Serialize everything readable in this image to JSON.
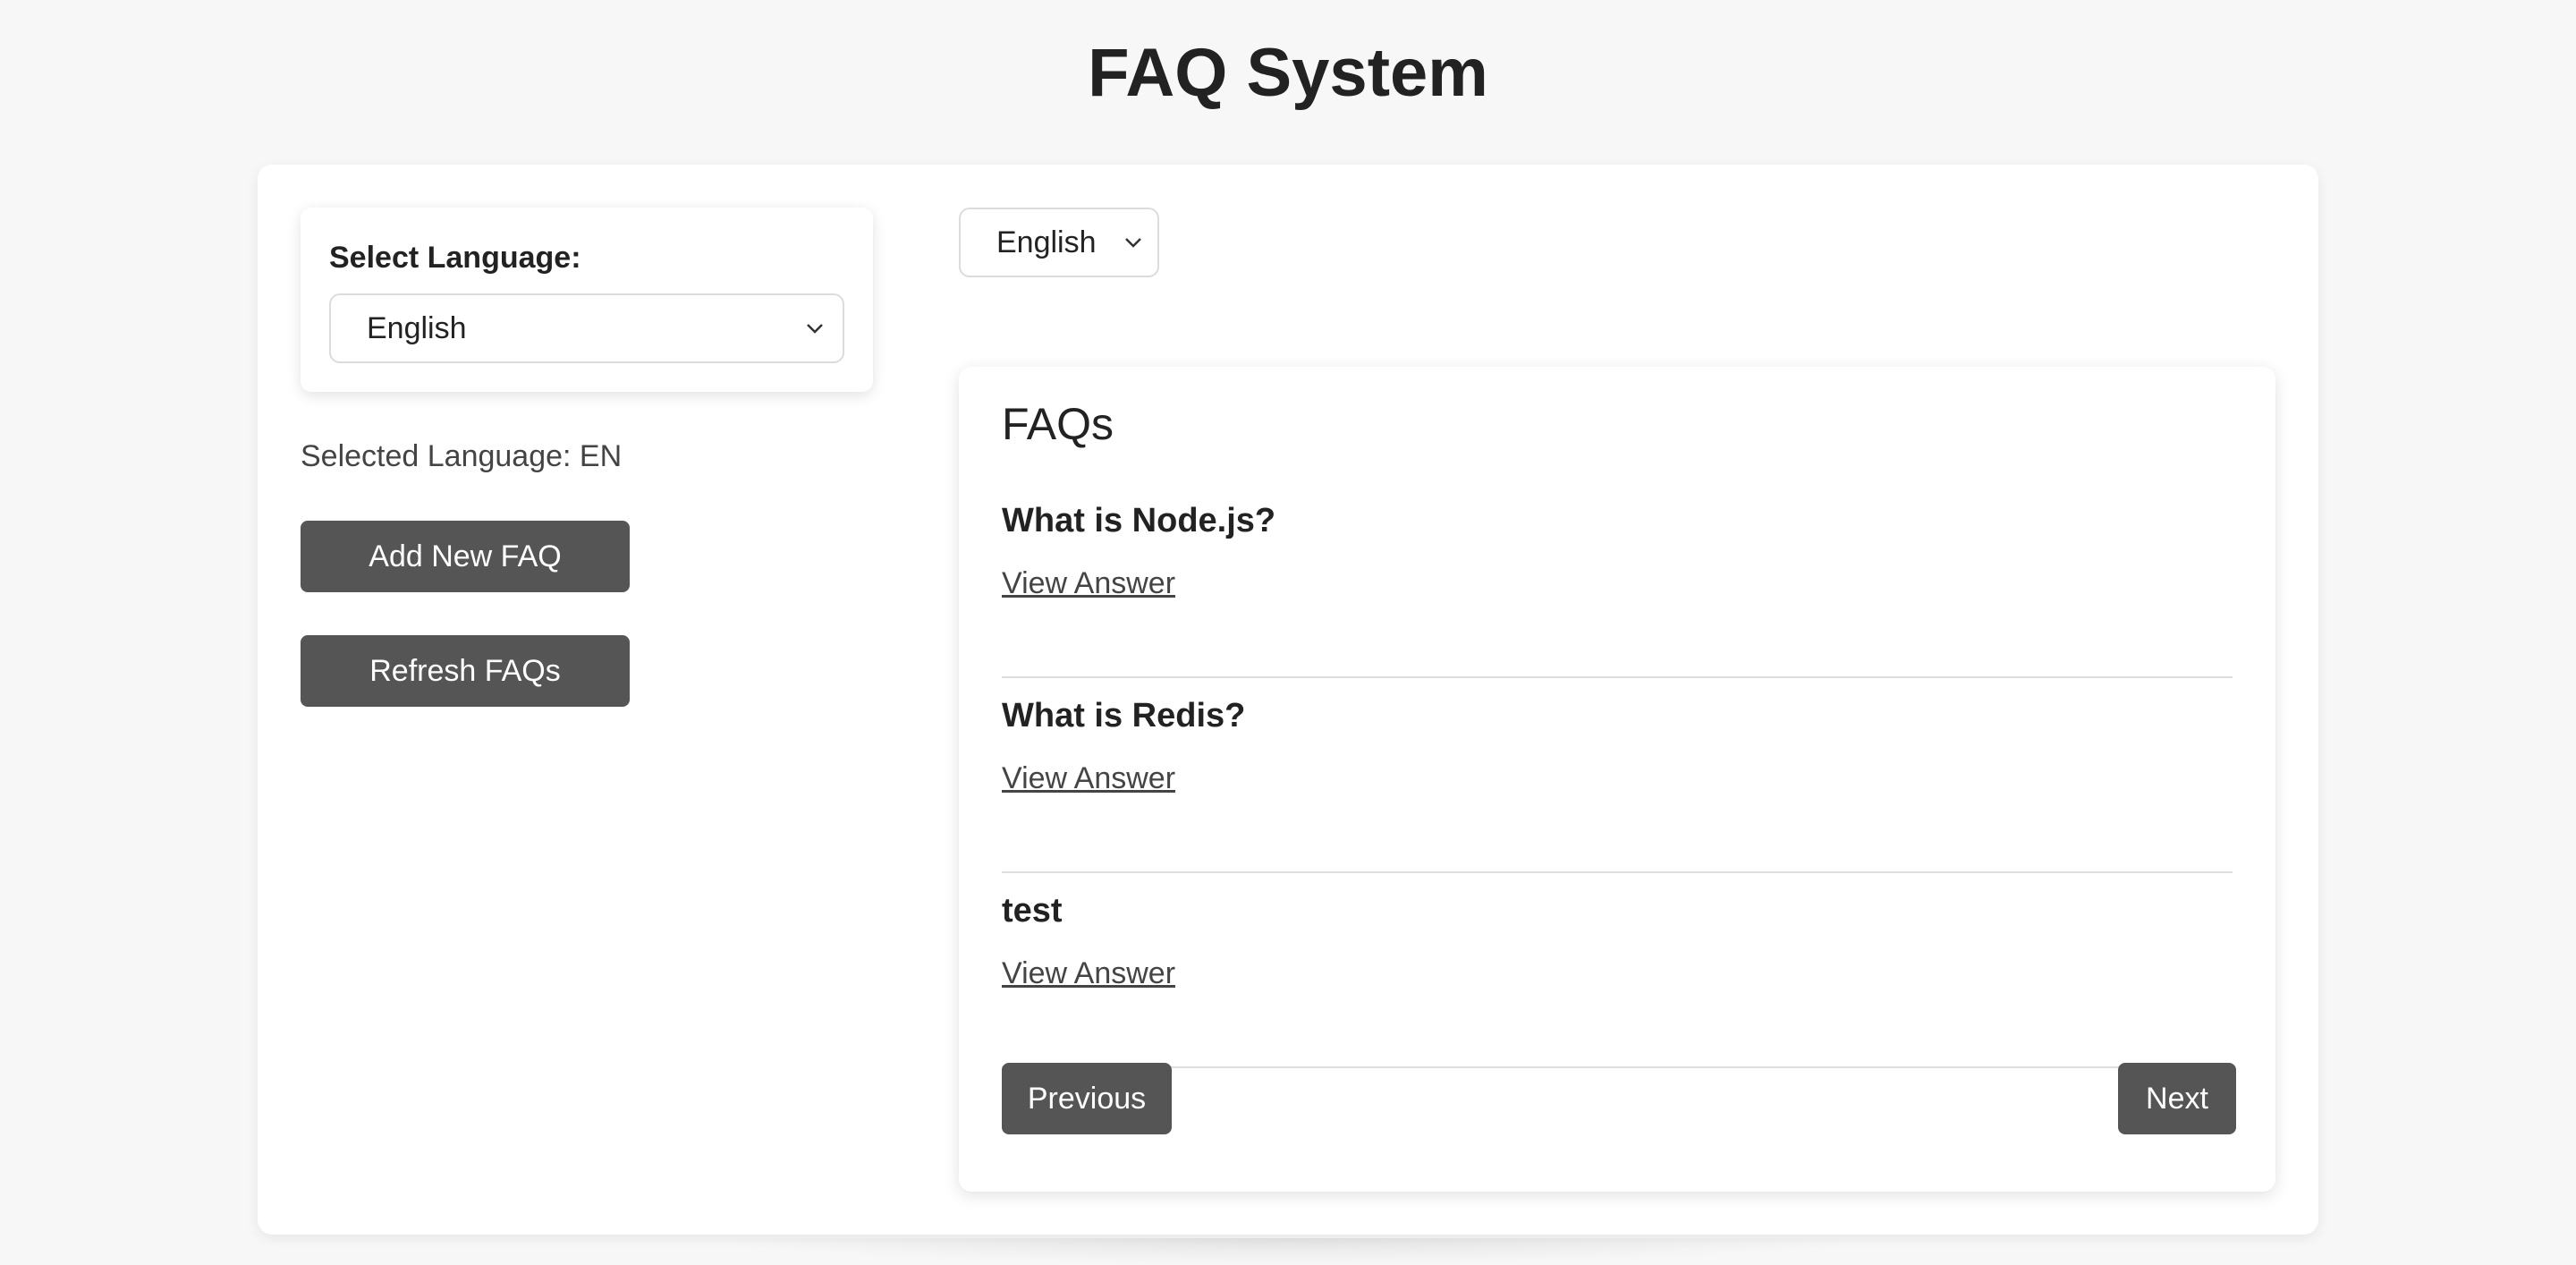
{
  "header": {
    "title": "FAQ System"
  },
  "sidebar": {
    "select_label": "Select Language:",
    "select_value": "English",
    "selected_language_text": "Selected Language: EN",
    "add_button_label": "Add New FAQ",
    "refresh_button_label": "Refresh FAQs"
  },
  "main": {
    "top_select_value": "English",
    "faq_heading": "FAQs",
    "faqs": [
      {
        "question": "What is Node.js?",
        "link_label": "View Answer"
      },
      {
        "question": "What is Redis?",
        "link_label": "View Answer"
      },
      {
        "question": "test",
        "link_label": "View Answer"
      }
    ],
    "pagination": {
      "previous_label": "Previous",
      "next_label": "Next"
    }
  },
  "icons": {
    "select_chevron": "chevron-down-icon"
  },
  "colors": {
    "page_background": "#f7f7f7",
    "card_background": "#ffffff",
    "button_background": "#555555",
    "button_text": "#ffffff",
    "divider": "#dddddd"
  }
}
